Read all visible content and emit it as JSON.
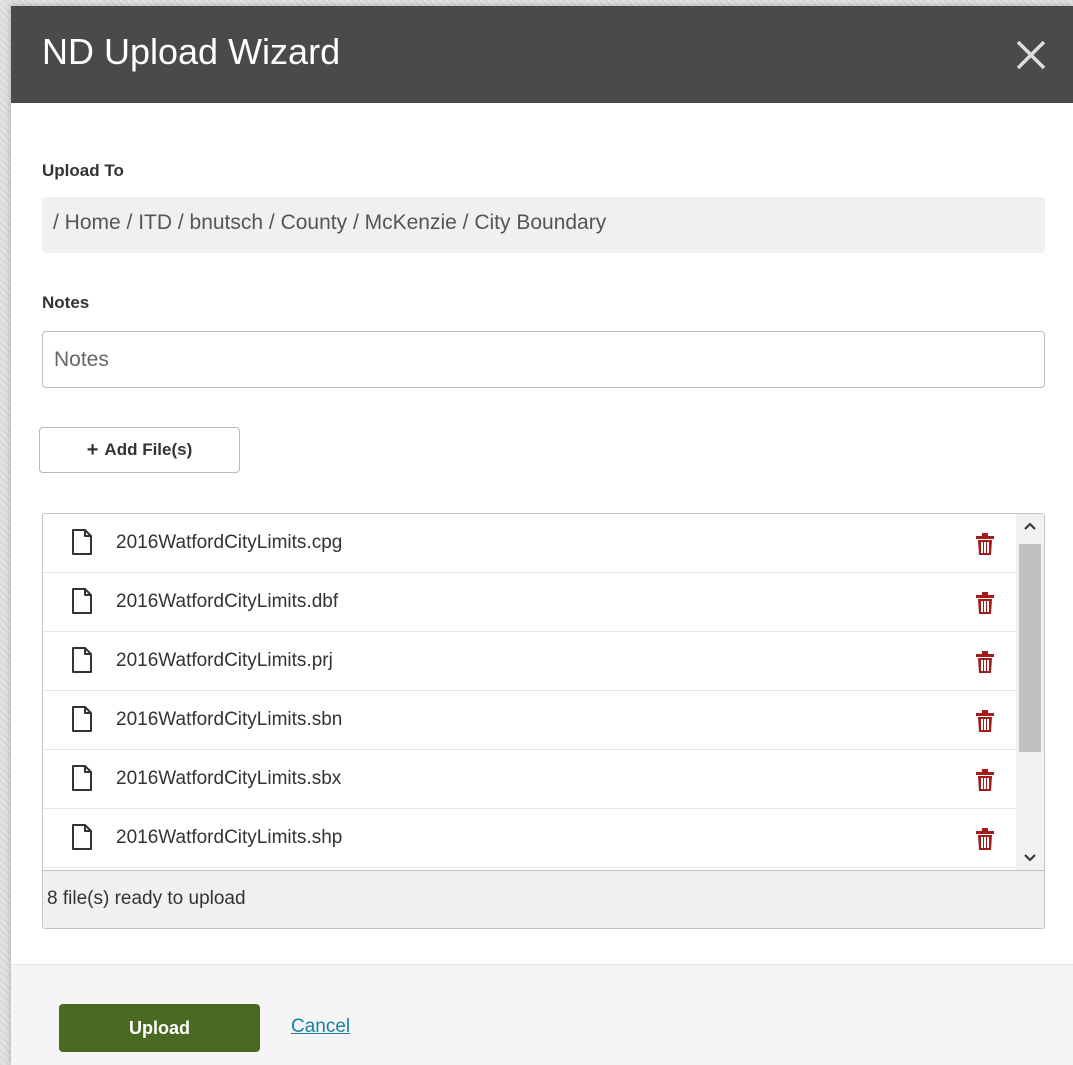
{
  "modal": {
    "title": "ND Upload Wizard",
    "close_icon": "close-icon"
  },
  "upload_to": {
    "label": "Upload To",
    "path": "/ Home / ITD / bnutsch / County / McKenzie / City Boundary"
  },
  "notes": {
    "label": "Notes",
    "placeholder": "Notes",
    "value": ""
  },
  "add_files": {
    "icon": "plus-icon",
    "label": "Add File(s)"
  },
  "files": [
    {
      "name": "2016WatfordCityLimits.cpg"
    },
    {
      "name": "2016WatfordCityLimits.dbf"
    },
    {
      "name": "2016WatfordCityLimits.prj"
    },
    {
      "name": "2016WatfordCityLimits.sbn"
    },
    {
      "name": "2016WatfordCityLimits.sbx"
    },
    {
      "name": "2016WatfordCityLimits.shp"
    }
  ],
  "file_status": "8 file(s) ready to upload",
  "footer": {
    "upload_label": "Upload",
    "cancel_label": "Cancel"
  },
  "colors": {
    "header_bg": "#4a4a4a",
    "upload_button": "#4a6a23",
    "trash_icon": "#a31c1c",
    "link": "#1a7ea4"
  }
}
